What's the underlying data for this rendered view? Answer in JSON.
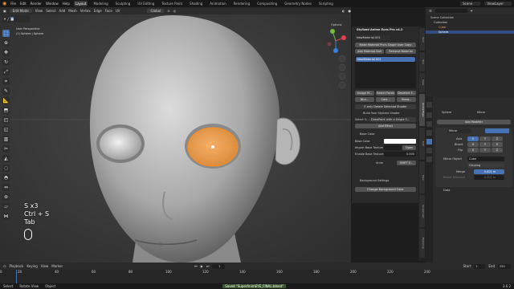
{
  "topbar": {
    "menus": [
      "File",
      "Edit",
      "Render",
      "Window",
      "Help"
    ],
    "workspaces": [
      "Layout",
      "Modeling",
      "Sculpting",
      "UV Editing",
      "Texture Paint",
      "Shading",
      "Animation",
      "Rendering",
      "Compositing",
      "Geometry Nodes",
      "Scripting"
    ],
    "active_workspace": "Layout",
    "scene_label": "Scene",
    "viewlayer_label": "ViewLayer"
  },
  "viewport": {
    "mode": "Edit Mode",
    "menu": [
      "View",
      "Select",
      "Add",
      "Mesh",
      "Vertex",
      "Edge",
      "Face",
      "UV"
    ],
    "transform": "Global",
    "perspective_label": "User Perspective",
    "object_label": "(1) Sphere | Sphere",
    "options_label": "Options",
    "keys": [
      "S x3",
      "Ctrl + S",
      "Tab"
    ]
  },
  "npanel": {
    "title": "Stylized Anime Eyes Pro v4.2",
    "material_name": "NewMaterial.001",
    "buttons": {
      "make_material": "Make Material Pro's Single User Copy",
      "add_material": "Add Material Null",
      "remove_material": "Remove Material",
      "assign": "Assign M...",
      "select_faces": "Select Faces",
      "deselect": "Deselect F...",
      "blur": "Blur...",
      "cast": "Cast...",
      "show": "Show...",
      "delete_shader": "F-only Delete Selected Shader",
      "build": "Build Your Stylized Shader",
      "add_effect": "Add Effect",
      "open": "Open",
      "anim": "Anim",
      "shift": "SHIFT E...",
      "change_bg": "Change Background Color"
    },
    "select_label": "Select G...",
    "select_value": "DrawPaint with a Single C...",
    "base_color_section": "Base Color",
    "base_color_label": "Base Color",
    "base_texture_label": "Import Base Texture",
    "enable_texture_label": "Enable Base Texture",
    "enable_value": "0.000",
    "background_section": "Background Settings"
  },
  "outliner": {
    "root": "Scene Collection",
    "items": [
      "Collection",
      "Cube",
      "Sphere"
    ]
  },
  "properties": {
    "object": "Sphere",
    "modifier_tab": "Mirror",
    "add_modifier": "Add Modifier",
    "modifier_name": "Mirror",
    "axis_label": "Axis",
    "bisect_label": "Bisect",
    "flip_label": "Flip",
    "axes": [
      "X",
      "Y",
      "Z"
    ],
    "mirror_object_label": "Mirror Object",
    "mirror_object_value": "Cube",
    "clipping_label": "Clipping",
    "merge_label": "Merge",
    "merge_value": "0.001 m",
    "bisect_distance_label": "Bisect Distance",
    "bisect_distance_value": "0.001 m",
    "data_label": "Data"
  },
  "timeline": {
    "menu": [
      "Playback",
      "Keying",
      "View",
      "Marker"
    ],
    "current_frame": "1",
    "start_label": "Start",
    "start_value": "1",
    "end_label": "End",
    "end_value": "250",
    "ticks": [
      "0",
      "20",
      "40",
      "60",
      "80",
      "100",
      "120",
      "140",
      "160",
      "180",
      "200",
      "220",
      "240"
    ]
  },
  "status": {
    "left": "Select",
    "middle": "Rotate View",
    "right": "Object",
    "saved": "Saved \"SuperAnimEYE_FINAL.blend\"",
    "version": "3.6.2"
  },
  "colors": {
    "accent": "#4772b3",
    "viewport_bg": "#3b3b3b",
    "eye_orange": "#f0a050",
    "selection_orange": "#ff8c1a"
  }
}
